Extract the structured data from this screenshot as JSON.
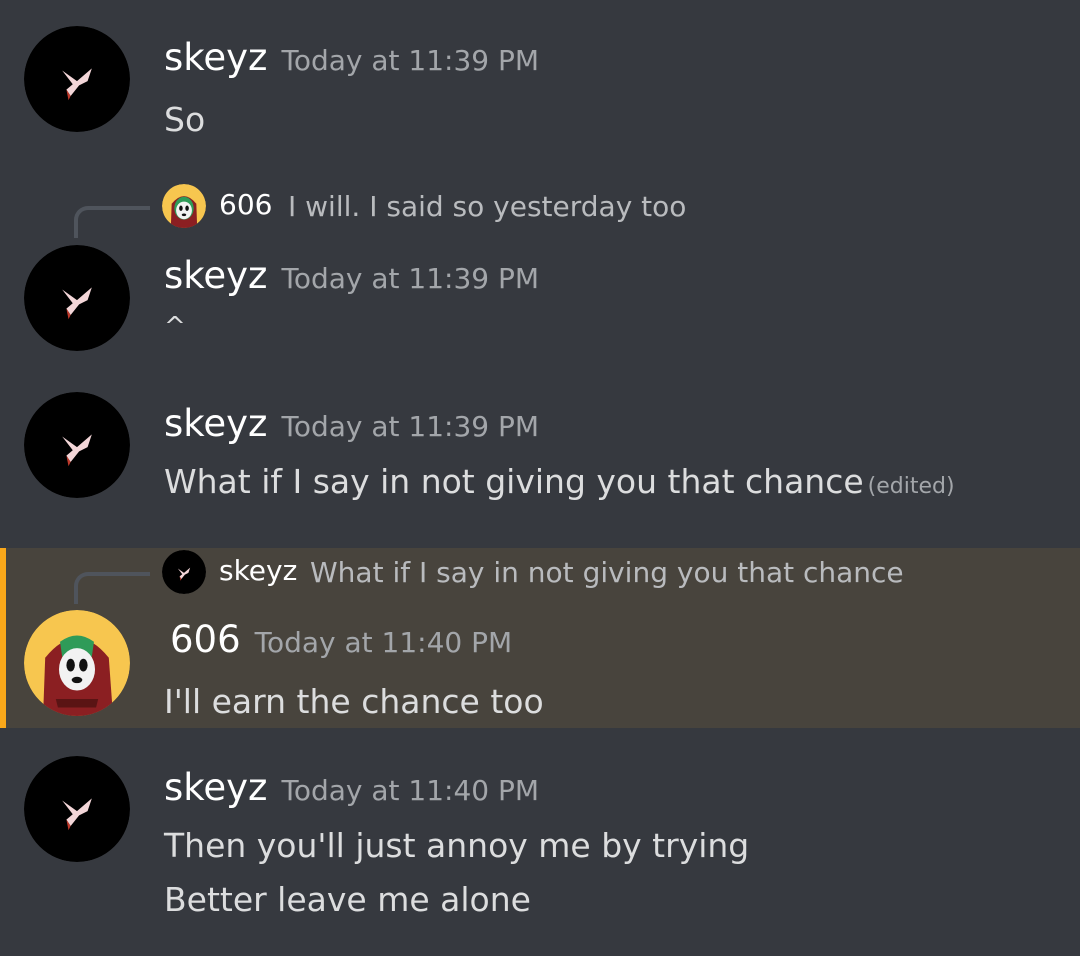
{
  "messages": [
    {
      "username": "skeyz",
      "timestamp": "Today at 11:39 PM",
      "lines": [
        "So"
      ]
    },
    {
      "reply": {
        "username": "606",
        "text": "I will. I said so yesterday too"
      },
      "username": "skeyz",
      "timestamp": "Today at 11:39 PM",
      "lines": [
        "^"
      ]
    },
    {
      "username": "skeyz",
      "timestamp": "Today at 11:39 PM",
      "lines": [
        "What if I say in not giving you that chance"
      ],
      "edited": "(edited)"
    },
    {
      "reply": {
        "username": "skeyz",
        "text": "What if I say in not giving you that chance"
      },
      "username": "606",
      "timestamp": "Today at 11:40 PM",
      "lines": [
        "I'll earn the chance too"
      ],
      "mention_highlight_color": "#faa81a"
    },
    {
      "username": "skeyz",
      "timestamp": "Today at 11:40 PM",
      "lines": [
        "Then you'll just annoy me by trying",
        "Better leave me alone"
      ]
    }
  ],
  "avatars": {
    "skeyz": "black-circle-pink-x-avatar",
    "606": "masked-hooded-character-avatar"
  },
  "colors": {
    "background": "#36393f",
    "highlight_background": "#48443d",
    "highlight_border": "#faa81a",
    "username": "#ffffff",
    "timestamp": "#a3a6aa"
  }
}
